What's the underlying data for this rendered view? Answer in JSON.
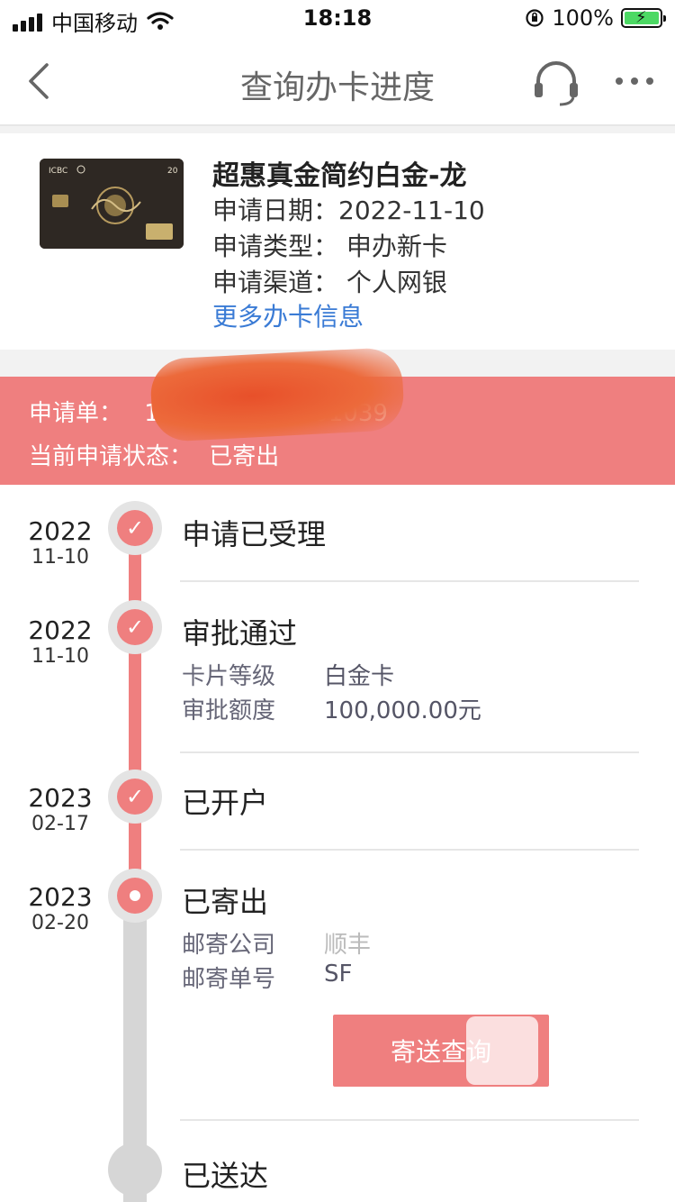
{
  "status_bar": {
    "carrier": "中国移动",
    "time": "18:18",
    "battery": "100%"
  },
  "nav": {
    "title": "查询办卡进度",
    "icons": [
      "back-icon",
      "headset-icon",
      "more-icon"
    ]
  },
  "card": {
    "name": "超惠真金简约白金-龙",
    "apply_date": "申请日期：2022-11-10",
    "apply_type": "申请类型：  申办新卡",
    "apply_channel": "申请渠道：  个人网银",
    "more_link": "更多办卡信息",
    "image_text": {
      "brand": "ICBC",
      "year": "20"
    }
  },
  "application": {
    "number_label": "申请单：",
    "number_visible": "100",
    "number_tail": "01039",
    "status_label": "当前申请状态：",
    "status_value": "已寄出"
  },
  "timeline": {
    "steps": [
      {
        "year": "2022",
        "md": "11-10",
        "title": "申请已受理"
      },
      {
        "year": "2022",
        "md": "11-10",
        "title": "审批通过",
        "details": [
          {
            "label": "卡片等级",
            "value": "白金卡"
          },
          {
            "label": "审批额度",
            "value": "100,000.00元"
          }
        ]
      },
      {
        "year": "2023",
        "md": "02-17",
        "title": "已开户"
      },
      {
        "year": "2023",
        "md": "02-20",
        "title": "已寄出",
        "details": [
          {
            "label": "邮寄公司",
            "value": "顺丰"
          },
          {
            "label": "邮寄单号",
            "value": "SF"
          }
        ],
        "button": "寄送查询"
      },
      {
        "title": "已送达"
      }
    ]
  },
  "colors": {
    "accent": "#ef7f7f",
    "link": "#3a7bd5",
    "track": "#d6d6d6"
  }
}
